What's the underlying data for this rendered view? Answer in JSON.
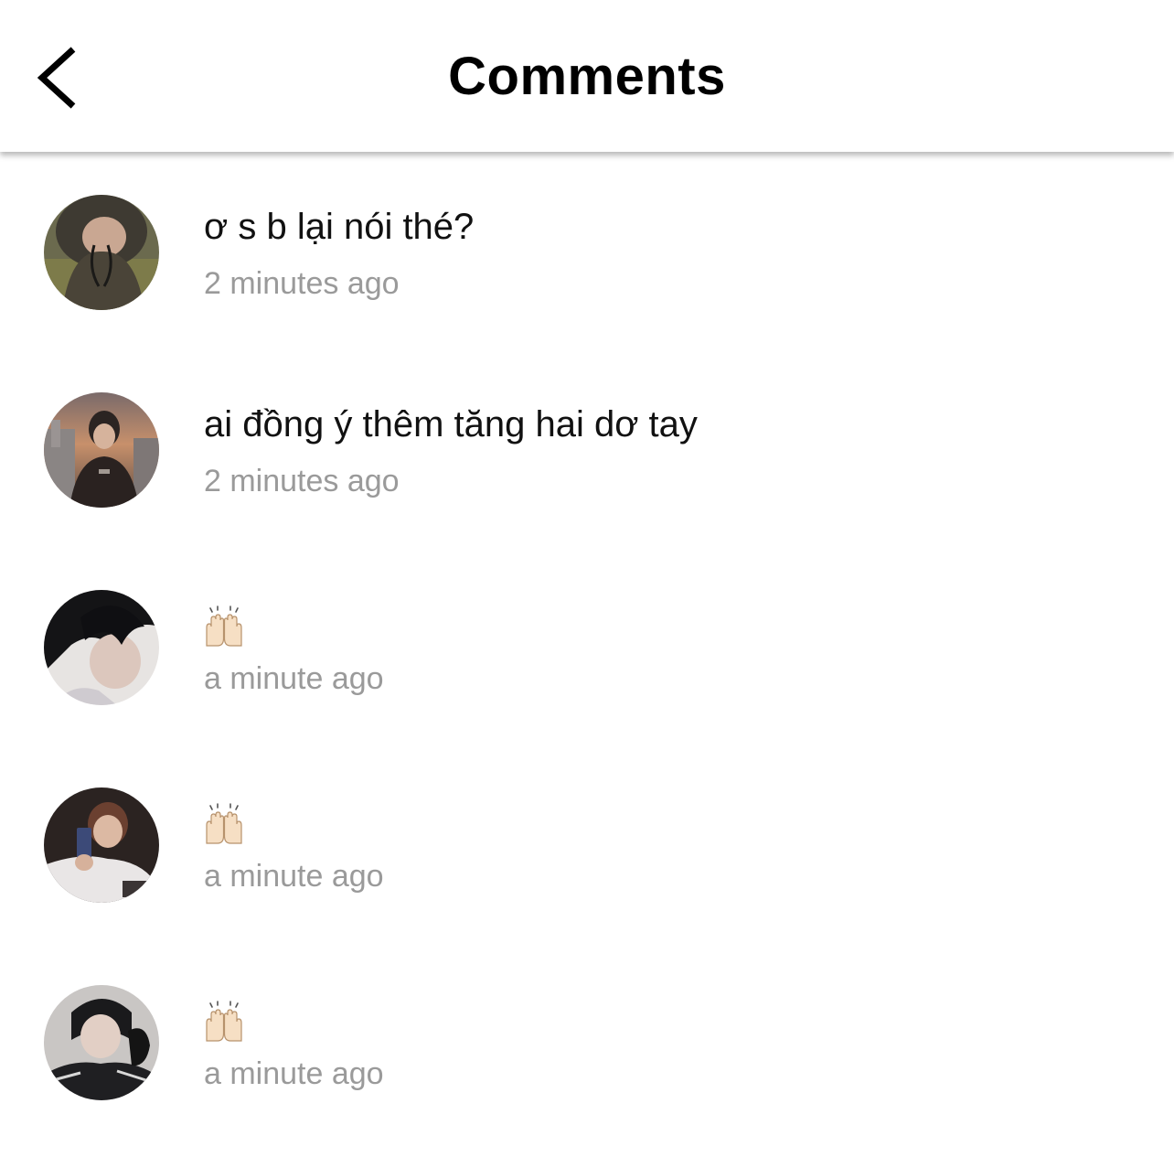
{
  "header": {
    "title": "Comments",
    "back_icon": "chevron-left-icon"
  },
  "comments": [
    {
      "text": "ơ s b lại nói thé?",
      "time": "2 minutes ago",
      "avatar": "avatar-1"
    },
    {
      "text": "ai đồng ý thêm tăng hai dơ tay",
      "time": "2 minutes ago",
      "avatar": "avatar-2"
    },
    {
      "text": "🙌🏻",
      "emoji_icon": "raising-hands-icon",
      "time": "a minute ago",
      "avatar": "avatar-3"
    },
    {
      "text": "🙌🏻",
      "emoji_icon": "raising-hands-icon",
      "time": "a minute ago",
      "avatar": "avatar-4"
    },
    {
      "text": "🙌🏻",
      "emoji_icon": "raising-hands-icon",
      "time": "a minute ago",
      "avatar": "avatar-5"
    }
  ],
  "colors": {
    "timestamp": "#9a9a9a",
    "text": "#111111",
    "background": "#ffffff"
  }
}
